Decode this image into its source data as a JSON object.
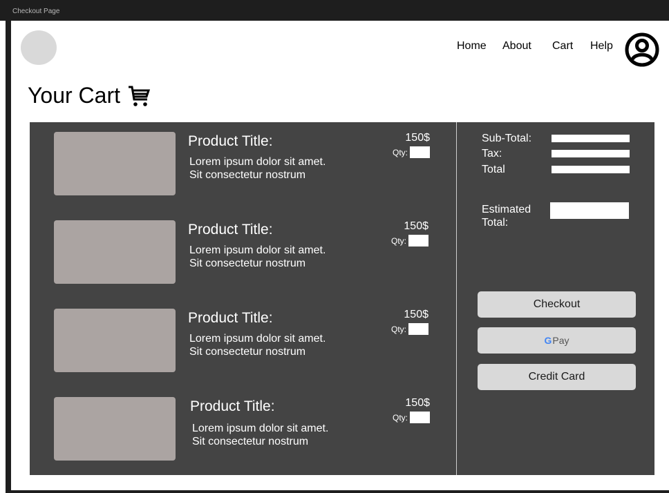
{
  "window": {
    "title": "Checkout Page"
  },
  "nav": {
    "links": [
      "Home",
      "About",
      "Cart",
      "Help"
    ],
    "user_icon": "user-circle-icon",
    "logo_icon": "logo-placeholder"
  },
  "page": {
    "heading": "Your Cart",
    "cart_icon": "shopping-cart-icon"
  },
  "products": [
    {
      "title": "Product Title:",
      "desc_line1": "Lorem ipsum dolor sit amet.",
      "desc_line2": "Sit consectetur nostrum",
      "price": "150$",
      "qty_label": "Qty:"
    },
    {
      "title": "Product Title:",
      "desc_line1": "Lorem ipsum dolor sit amet.",
      "desc_line2": "Sit consectetur nostrum",
      "price": "150$",
      "qty_label": "Qty:"
    },
    {
      "title": "Product Title:",
      "desc_line1": "Lorem ipsum dolor sit amet.",
      "desc_line2": "Sit consectetur nostrum",
      "price": "150$",
      "qty_label": "Qty:"
    },
    {
      "title": "Product Title:",
      "desc_line1": "Lorem ipsum dolor sit amet.",
      "desc_line2": "Sit consectetur nostrum",
      "price": "150$",
      "qty_label": "Qty:"
    }
  ],
  "summary": {
    "subtotal_label": "Sub-Total:",
    "tax_label": "Tax:",
    "total_label": "Total",
    "estimated_label_line1": "Estimated",
    "estimated_label_line2": "Total:"
  },
  "payment": {
    "checkout_label": "Checkout",
    "gpay_g": "G",
    "gpay_label": "Pay",
    "credit_card_label": "Credit Card"
  },
  "colors": {
    "panel": "#444444",
    "product_image": "#aba4a2",
    "button": "#d9d9d9",
    "frame": "#1e1e1e"
  }
}
